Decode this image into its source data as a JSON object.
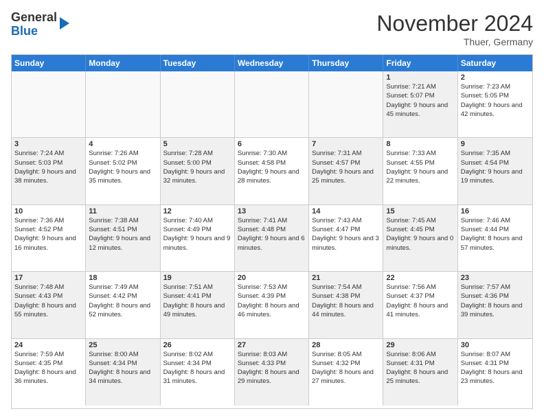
{
  "logo": {
    "general": "General",
    "blue": "Blue"
  },
  "header": {
    "month": "November 2024",
    "location": "Thuer, Germany"
  },
  "weekdays": [
    "Sunday",
    "Monday",
    "Tuesday",
    "Wednesday",
    "Thursday",
    "Friday",
    "Saturday"
  ],
  "rows": [
    [
      {
        "day": "",
        "info": ""
      },
      {
        "day": "",
        "info": ""
      },
      {
        "day": "",
        "info": ""
      },
      {
        "day": "",
        "info": ""
      },
      {
        "day": "",
        "info": ""
      },
      {
        "day": "1",
        "info": "Sunrise: 7:21 AM\nSunset: 5:07 PM\nDaylight: 9 hours and 45 minutes."
      },
      {
        "day": "2",
        "info": "Sunrise: 7:23 AM\nSunset: 5:05 PM\nDaylight: 9 hours and 42 minutes."
      }
    ],
    [
      {
        "day": "3",
        "info": "Sunrise: 7:24 AM\nSunset: 5:03 PM\nDaylight: 9 hours and 38 minutes."
      },
      {
        "day": "4",
        "info": "Sunrise: 7:26 AM\nSunset: 5:02 PM\nDaylight: 9 hours and 35 minutes."
      },
      {
        "day": "5",
        "info": "Sunrise: 7:28 AM\nSunset: 5:00 PM\nDaylight: 9 hours and 32 minutes."
      },
      {
        "day": "6",
        "info": "Sunrise: 7:30 AM\nSunset: 4:58 PM\nDaylight: 9 hours and 28 minutes."
      },
      {
        "day": "7",
        "info": "Sunrise: 7:31 AM\nSunset: 4:57 PM\nDaylight: 9 hours and 25 minutes."
      },
      {
        "day": "8",
        "info": "Sunrise: 7:33 AM\nSunset: 4:55 PM\nDaylight: 9 hours and 22 minutes."
      },
      {
        "day": "9",
        "info": "Sunrise: 7:35 AM\nSunset: 4:54 PM\nDaylight: 9 hours and 19 minutes."
      }
    ],
    [
      {
        "day": "10",
        "info": "Sunrise: 7:36 AM\nSunset: 4:52 PM\nDaylight: 9 hours and 16 minutes."
      },
      {
        "day": "11",
        "info": "Sunrise: 7:38 AM\nSunset: 4:51 PM\nDaylight: 9 hours and 12 minutes."
      },
      {
        "day": "12",
        "info": "Sunrise: 7:40 AM\nSunset: 4:49 PM\nDaylight: 9 hours and 9 minutes."
      },
      {
        "day": "13",
        "info": "Sunrise: 7:41 AM\nSunset: 4:48 PM\nDaylight: 9 hours and 6 minutes."
      },
      {
        "day": "14",
        "info": "Sunrise: 7:43 AM\nSunset: 4:47 PM\nDaylight: 9 hours and 3 minutes."
      },
      {
        "day": "15",
        "info": "Sunrise: 7:45 AM\nSunset: 4:45 PM\nDaylight: 9 hours and 0 minutes."
      },
      {
        "day": "16",
        "info": "Sunrise: 7:46 AM\nSunset: 4:44 PM\nDaylight: 8 hours and 57 minutes."
      }
    ],
    [
      {
        "day": "17",
        "info": "Sunrise: 7:48 AM\nSunset: 4:43 PM\nDaylight: 8 hours and 55 minutes."
      },
      {
        "day": "18",
        "info": "Sunrise: 7:49 AM\nSunset: 4:42 PM\nDaylight: 8 hours and 52 minutes."
      },
      {
        "day": "19",
        "info": "Sunrise: 7:51 AM\nSunset: 4:41 PM\nDaylight: 8 hours and 49 minutes."
      },
      {
        "day": "20",
        "info": "Sunrise: 7:53 AM\nSunset: 4:39 PM\nDaylight: 8 hours and 46 minutes."
      },
      {
        "day": "21",
        "info": "Sunrise: 7:54 AM\nSunset: 4:38 PM\nDaylight: 8 hours and 44 minutes."
      },
      {
        "day": "22",
        "info": "Sunrise: 7:56 AM\nSunset: 4:37 PM\nDaylight: 8 hours and 41 minutes."
      },
      {
        "day": "23",
        "info": "Sunrise: 7:57 AM\nSunset: 4:36 PM\nDaylight: 8 hours and 39 minutes."
      }
    ],
    [
      {
        "day": "24",
        "info": "Sunrise: 7:59 AM\nSunset: 4:35 PM\nDaylight: 8 hours and 36 minutes."
      },
      {
        "day": "25",
        "info": "Sunrise: 8:00 AM\nSunset: 4:34 PM\nDaylight: 8 hours and 34 minutes."
      },
      {
        "day": "26",
        "info": "Sunrise: 8:02 AM\nSunset: 4:34 PM\nDaylight: 8 hours and 31 minutes."
      },
      {
        "day": "27",
        "info": "Sunrise: 8:03 AM\nSunset: 4:33 PM\nDaylight: 8 hours and 29 minutes."
      },
      {
        "day": "28",
        "info": "Sunrise: 8:05 AM\nSunset: 4:32 PM\nDaylight: 8 hours and 27 minutes."
      },
      {
        "day": "29",
        "info": "Sunrise: 8:06 AM\nSunset: 4:31 PM\nDaylight: 8 hours and 25 minutes."
      },
      {
        "day": "30",
        "info": "Sunrise: 8:07 AM\nSunset: 4:31 PM\nDaylight: 8 hours and 23 minutes."
      }
    ]
  ]
}
